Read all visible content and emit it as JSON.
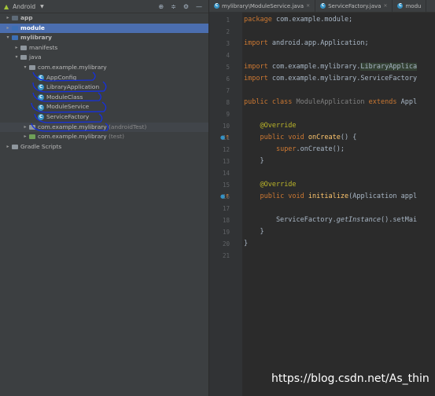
{
  "panel": {
    "title": "Android"
  },
  "tree": [
    {
      "label": "app",
      "bold": true,
      "indent": 0,
      "arrow": ">",
      "icon": "folder-dark"
    },
    {
      "label": "module",
      "bold": true,
      "indent": 0,
      "arrow": ">",
      "icon": "folder-blue",
      "selected": true
    },
    {
      "label": "mylibrary",
      "bold": true,
      "indent": 0,
      "arrow": "v",
      "icon": "folder-blue"
    },
    {
      "label": "manifests",
      "indent": 1,
      "arrow": ">",
      "icon": "folder-gray"
    },
    {
      "label": "java",
      "indent": 1,
      "arrow": "v",
      "icon": "folder-gray"
    },
    {
      "label": "com.example.mylibrary",
      "indent": 2,
      "arrow": "v",
      "icon": "folder-gray"
    },
    {
      "label": "AppConfig",
      "indent": 3,
      "icon": "class"
    },
    {
      "label": "LibraryApplication",
      "indent": 3,
      "icon": "class"
    },
    {
      "label": "ModuleClass",
      "indent": 3,
      "icon": "class"
    },
    {
      "label": "ModuleService",
      "indent": 3,
      "icon": "class"
    },
    {
      "label": "ServiceFactory",
      "indent": 3,
      "icon": "class"
    },
    {
      "label": "com.example.mylibrary",
      "suffix": "(androidTest)",
      "indent": 2,
      "arrow": ">",
      "icon": "folder-gray",
      "muted": true
    },
    {
      "label": "com.example.mylibrary",
      "suffix": "(test)",
      "indent": 2,
      "arrow": ">",
      "icon": "folder-green"
    },
    {
      "label": "Gradle Scripts",
      "indent": 0,
      "arrow": ">",
      "icon": "gradle"
    }
  ],
  "tabs": [
    {
      "label": "mylibrary\\ModuleService.java"
    },
    {
      "label": "ServiceFactory.java"
    },
    {
      "label": "modu"
    }
  ],
  "lines": [
    {
      "n": "1",
      "html": "<span class='kw'>package</span> com.example.module;"
    },
    {
      "n": "2",
      "html": ""
    },
    {
      "n": "3",
      "html": "<span class='kw'>import</span> android.app.Application;"
    },
    {
      "n": "4",
      "html": ""
    },
    {
      "n": "5",
      "html": "<span class='kw'>import</span> com.example.mylibrary.<span class='hl'>LibraryApplica</span>"
    },
    {
      "n": "6",
      "html": "<span class='kw'>import</span> com.example.mylibrary.ServiceFactory"
    },
    {
      "n": "7",
      "html": ""
    },
    {
      "n": "8",
      "html": "<span class='kw'>public class</span> <span class='gr'>ModuleApplication</span> <span class='kw'>extends</span> Appl"
    },
    {
      "n": "9",
      "html": ""
    },
    {
      "n": "10",
      "html": "    <span class='ann'>@Override</span>"
    },
    {
      "n": "11",
      "html": "    <span class='kw'>public void</span> <span class='fn'>onCreate</span>() {"
    },
    {
      "n": "12",
      "html": "        <span class='kw'>super</span>.onCreate();"
    },
    {
      "n": "13",
      "html": "    }"
    },
    {
      "n": "14",
      "html": ""
    },
    {
      "n": "15",
      "html": "    <span class='ann'>@Override</span>"
    },
    {
      "n": "16",
      "html": "    <span class='kw'>public void</span> <span class='fn'>initialize</span>(Application appl"
    },
    {
      "n": "17",
      "html": ""
    },
    {
      "n": "18",
      "html": "        ServiceFactory.<span class='it'>getInstance</span>().setMai"
    },
    {
      "n": "19",
      "html": "    }"
    },
    {
      "n": "20",
      "html": "}"
    },
    {
      "n": "21",
      "html": ""
    }
  ],
  "watermark": "https://blog.csdn.net/As_thin"
}
